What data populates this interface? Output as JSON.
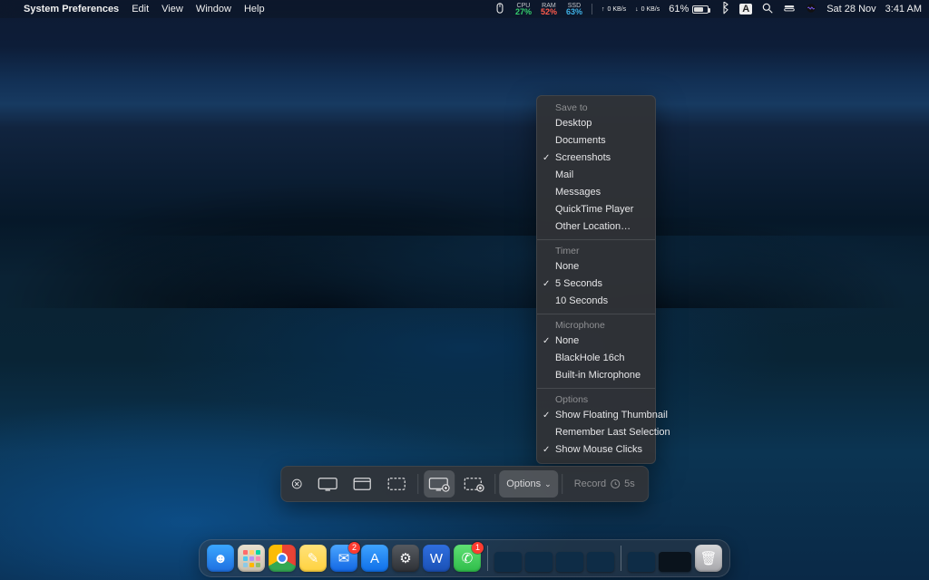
{
  "menubar": {
    "app": "System Preferences",
    "menus": [
      "Edit",
      "View",
      "Window",
      "Help"
    ],
    "stats": {
      "cpu_label": "CPU",
      "cpu_value": "27%",
      "ram_label": "RAM",
      "ram_value": "52%",
      "ssd_label": "SSD",
      "ssd_value": "63%"
    },
    "net_up": "0 KB/s",
    "net_down": "0 KB/s",
    "battery_pct": "61%",
    "input_source": "A",
    "date": "Sat 28 Nov",
    "time": "3:41 AM"
  },
  "screenshot_toolbar": {
    "options_label": "Options",
    "record_label": "Record",
    "record_timer": "5s"
  },
  "options_menu": {
    "sections": [
      {
        "title": "Save to",
        "items": [
          {
            "label": "Desktop",
            "checked": false
          },
          {
            "label": "Documents",
            "checked": false
          },
          {
            "label": "Screenshots",
            "checked": true
          },
          {
            "label": "Mail",
            "checked": false
          },
          {
            "label": "Messages",
            "checked": false
          },
          {
            "label": "QuickTime Player",
            "checked": false
          },
          {
            "label": "Other Location…",
            "checked": false
          }
        ]
      },
      {
        "title": "Timer",
        "items": [
          {
            "label": "None",
            "checked": false
          },
          {
            "label": "5 Seconds",
            "checked": true
          },
          {
            "label": "10 Seconds",
            "checked": false
          }
        ]
      },
      {
        "title": "Microphone",
        "items": [
          {
            "label": "None",
            "checked": true
          },
          {
            "label": "BlackHole 16ch",
            "checked": false
          },
          {
            "label": "Built-in Microphone",
            "checked": false
          }
        ]
      },
      {
        "title": "Options",
        "items": [
          {
            "label": "Show Floating Thumbnail",
            "checked": true
          },
          {
            "label": "Remember Last Selection",
            "checked": false
          },
          {
            "label": "Show Mouse Clicks",
            "checked": true
          }
        ]
      }
    ]
  },
  "dock": {
    "apps": [
      {
        "name": "finder",
        "color": "linear-gradient(#3aa7ff,#1e6fe0)",
        "glyph": "☻"
      },
      {
        "name": "launchpad",
        "color": "linear-gradient(#e8e0d0,#c9c0af)",
        "glyph": "▦"
      },
      {
        "name": "chrome",
        "color": "#fff",
        "glyph": "◉"
      },
      {
        "name": "notes",
        "color": "linear-gradient(#ffe27a,#ffd23f)",
        "glyph": "✎"
      },
      {
        "name": "mail",
        "color": "linear-gradient(#4aa6ff,#1266e3)",
        "glyph": "✉",
        "badge": "2"
      },
      {
        "name": "appstore",
        "color": "linear-gradient(#3ea3ff,#0f6fe8)",
        "glyph": "A"
      },
      {
        "name": "system-preferences",
        "color": "linear-gradient(#565a60,#2e3136)",
        "glyph": "⚙"
      },
      {
        "name": "word",
        "color": "linear-gradient(#2f6fe0,#1a50b5)",
        "glyph": "W"
      },
      {
        "name": "messages",
        "color": "linear-gradient(#5fe074,#2fbd4a)",
        "glyph": "✆",
        "badge": "1"
      }
    ]
  }
}
